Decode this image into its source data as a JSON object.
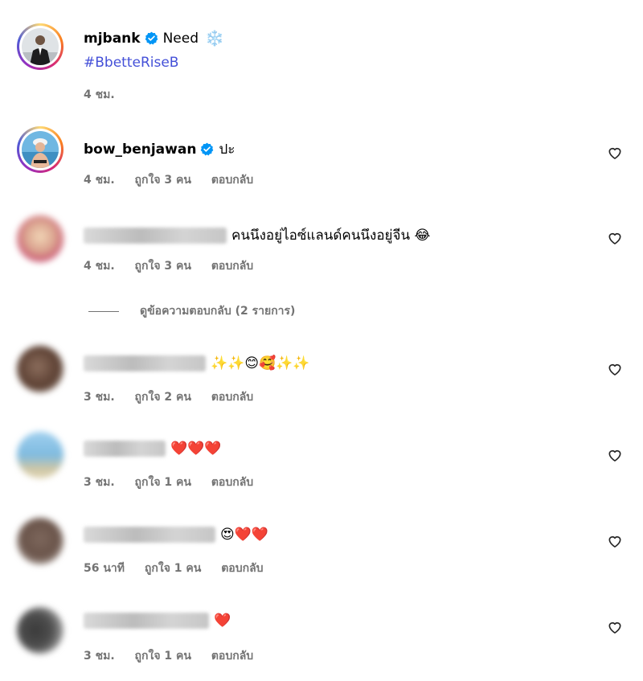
{
  "post": {
    "username": "mjbank",
    "text": "Need",
    "emoji": "❄️",
    "hashtag": "#BbetteRiseB",
    "time": "4 ชม."
  },
  "comments": [
    {
      "username": "bow_benjawan",
      "verified": true,
      "text": "ปะ",
      "time": "4 ชม.",
      "likes": "ถูกใจ 3 คน",
      "reply": "ตอบกลับ",
      "heart_icon": "heart-outline-icon"
    },
    {
      "username": "",
      "blurred": true,
      "text": "คนนึงอยู่ไอซ์แลนด์คนนึงอยู่จีน 😂",
      "time": "4 ชม.",
      "likes": "ถูกใจ 3 คน",
      "reply": "ตอบกลับ"
    },
    {
      "username": "",
      "blurred": true,
      "text": "✨✨😊🥰✨✨",
      "time": "3 ชม.",
      "likes": "ถูกใจ 2 คน",
      "reply": "ตอบกลับ"
    },
    {
      "username": "",
      "blurred": true,
      "text": "❤️❤️❤️",
      "time": "3 ชม.",
      "likes": "ถูกใจ 1 คน",
      "reply": "ตอบกลับ"
    },
    {
      "username": "",
      "blurred": true,
      "text": "😍❤️❤️",
      "time": "56 นาที",
      "likes": "ถูกใจ 1 คน",
      "reply": "ตอบกลับ"
    },
    {
      "username": "",
      "blurred": true,
      "text": "❤️",
      "time": "3 ชม.",
      "likes": "ถูกใจ 1 คน",
      "reply": "ตอบกลับ"
    }
  ],
  "view_replies": "ดูข้อความตอบกลับ (2 รายการ)",
  "colors": {
    "hashtag": "#4450d8",
    "verified": "#0095f6",
    "meta": "#737373"
  }
}
